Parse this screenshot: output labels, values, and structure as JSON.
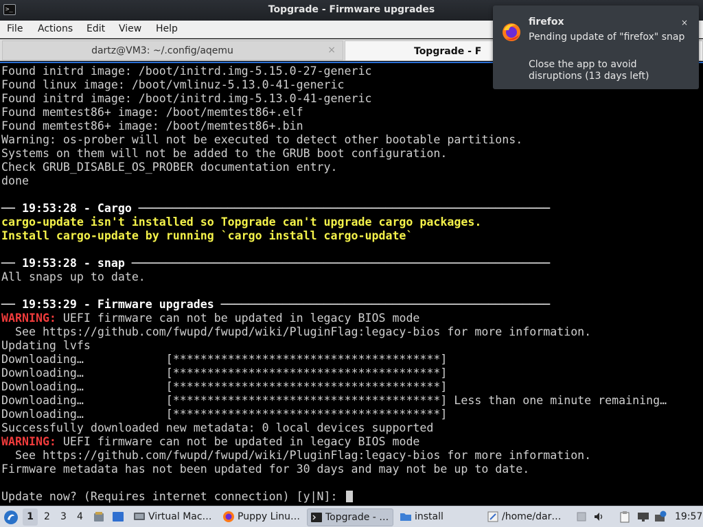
{
  "window": {
    "title": "Topgrade - Firmware upgrades",
    "app_icon_glyph": ">_"
  },
  "menubar": {
    "items": [
      "File",
      "Actions",
      "Edit",
      "View",
      "Help"
    ]
  },
  "tabs": [
    {
      "label": "dartz@VM3: ~/.config/aqemu",
      "active": false,
      "close_glyph": "×"
    },
    {
      "label": "Topgrade - F",
      "active": true
    }
  ],
  "terminal": {
    "lines": [
      {
        "text": "Found initrd image: /boot/initrd.img-5.15.0-27-generic"
      },
      {
        "text": "Found linux image: /boot/vmlinuz-5.13.0-41-generic"
      },
      {
        "text": "Found initrd image: /boot/initrd.img-5.13.0-41-generic"
      },
      {
        "text": "Found memtest86+ image: /boot/memtest86+.elf"
      },
      {
        "text": "Found memtest86+ image: /boot/memtest86+.bin"
      },
      {
        "text": "Warning: os-prober will not be executed to detect other bootable partitions."
      },
      {
        "text": "Systems on them will not be added to the GRUB boot configuration."
      },
      {
        "text": "Check GRUB_DISABLE_OS_PROBER documentation entry."
      },
      {
        "text": "done"
      },
      {
        "text": ""
      },
      {
        "text": "── 19:53:28 - Cargo ────────────────────────────────────────────────────────────",
        "style": "heading"
      },
      {
        "text": "cargo-update isn't installed so Topgrade can't upgrade cargo packages.",
        "style": "yellow"
      },
      {
        "text": "Install cargo-update by running `cargo install cargo-update`",
        "style": "yellow"
      },
      {
        "text": ""
      },
      {
        "text": "── 19:53:28 - snap ─────────────────────────────────────────────────────────────",
        "style": "heading"
      },
      {
        "text": "All snaps up to date."
      },
      {
        "text": ""
      },
      {
        "text": "── 19:53:29 - Firmware upgrades ────────────────────────────────────────────────",
        "style": "heading"
      },
      {
        "label": "WARNING:",
        "text": " UEFI firmware can not be updated in legacy BIOS mode",
        "style": "warn"
      },
      {
        "text": "  See https://github.com/fwupd/fwupd/wiki/PluginFlag:legacy-bios for more information."
      },
      {
        "text": "Updating lvfs"
      },
      {
        "text": "Downloading…            [***************************************]"
      },
      {
        "text": "Downloading…            [***************************************]"
      },
      {
        "text": "Downloading…            [***************************************]"
      },
      {
        "text": "Downloading…            [***************************************] Less than one minute remaining…"
      },
      {
        "text": "Downloading…            [***************************************]"
      },
      {
        "text": "Successfully downloaded new metadata: 0 local devices supported"
      },
      {
        "label": "WARNING:",
        "text": " UEFI firmware can not be updated in legacy BIOS mode",
        "style": "warn"
      },
      {
        "text": "  See https://github.com/fwupd/fwupd/wiki/PluginFlag:legacy-bios for more information."
      },
      {
        "text": "Firmware metadata has not been updated for 30 days and may not be up to date."
      },
      {
        "text": ""
      },
      {
        "text": "Update now? (Requires internet connection) [y|N]: ",
        "cursor": true
      }
    ]
  },
  "notification": {
    "app": "firefox",
    "body": "Pending update of \"firefox\" snap",
    "detail": "Close the app to avoid disruptions (13 days left)",
    "close_glyph": "×",
    "icon": "firefox-icon"
  },
  "taskbar": {
    "workspaces": [
      "1",
      "2",
      "3",
      "4"
    ],
    "tasks": [
      {
        "label": "Virtual Mac…",
        "icon": "virtual-machine-icon"
      },
      {
        "label": "Puppy Linu…",
        "icon": "firefox-icon"
      },
      {
        "label": "Topgrade - …",
        "icon": "terminal-icon",
        "current": true
      },
      {
        "label": "install",
        "icon": "folder-icon"
      },
      {
        "label": "/home/dar…",
        "icon": "text-editor-icon"
      }
    ],
    "clock": "19:57"
  }
}
